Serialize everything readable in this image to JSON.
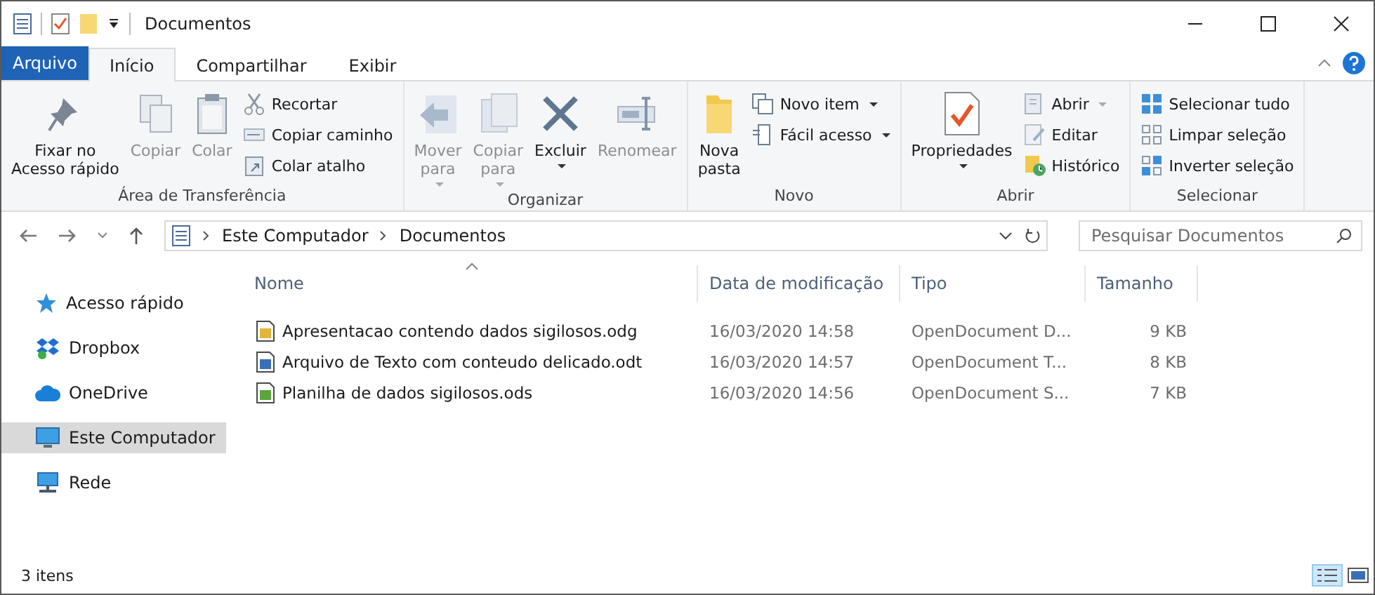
{
  "window": {
    "title": "Documentos"
  },
  "tabs": [
    {
      "label": "Arquivo",
      "kind": "menu"
    },
    {
      "label": "Início",
      "kind": "tab",
      "selected": true
    },
    {
      "label": "Compartilhar",
      "kind": "tab",
      "selected": false
    },
    {
      "label": "Exibir",
      "kind": "tab",
      "selected": false
    }
  ],
  "ribbon": {
    "groups": [
      {
        "label": "Área de Transferência",
        "items": [
          {
            "kind": "large",
            "label": "Fixar no\nAcesso rápido",
            "disabled": false,
            "dropdown": false
          },
          {
            "kind": "large",
            "label": "Copiar",
            "disabled": true,
            "dropdown": false
          },
          {
            "kind": "large",
            "label": "Colar",
            "disabled": true,
            "dropdown": false
          },
          {
            "kind": "small",
            "label": "Recortar",
            "disabled": true,
            "dropdown": false
          },
          {
            "kind": "small",
            "label": "Copiar caminho",
            "disabled": true,
            "dropdown": false
          },
          {
            "kind": "small",
            "label": "Colar atalho",
            "disabled": true,
            "dropdown": false
          }
        ]
      },
      {
        "label": "Organizar",
        "items": [
          {
            "kind": "large",
            "label": "Mover\npara",
            "disabled": true,
            "dropdown": true
          },
          {
            "kind": "large",
            "label": "Copiar\npara",
            "disabled": true,
            "dropdown": true
          },
          {
            "kind": "large",
            "label": "Excluir",
            "disabled": false,
            "dropdown": true
          },
          {
            "kind": "large",
            "label": "Renomear",
            "disabled": true,
            "dropdown": false
          }
        ]
      },
      {
        "label": "Novo",
        "items": [
          {
            "kind": "large",
            "label": "Nova\npasta",
            "disabled": false,
            "dropdown": false
          },
          {
            "kind": "small",
            "label": "Novo item",
            "disabled": false,
            "dropdown": true
          },
          {
            "kind": "small",
            "label": "Fácil acesso",
            "disabled": false,
            "dropdown": true
          }
        ]
      },
      {
        "label": "Abrir",
        "items": [
          {
            "kind": "large",
            "label": "Propriedades",
            "disabled": false,
            "dropdown": true
          },
          {
            "kind": "small",
            "label": "Abrir",
            "disabled": true,
            "dropdown": true
          },
          {
            "kind": "small",
            "label": "Editar",
            "disabled": true,
            "dropdown": false
          },
          {
            "kind": "small",
            "label": "Histórico",
            "disabled": false,
            "dropdown": false
          }
        ]
      },
      {
        "label": "Selecionar",
        "items": [
          {
            "kind": "small",
            "label": "Selecionar tudo",
            "disabled": false,
            "dropdown": false
          },
          {
            "kind": "small",
            "label": "Limpar seleção",
            "disabled": false,
            "dropdown": false
          },
          {
            "kind": "small",
            "label": "Inverter seleção",
            "disabled": false,
            "dropdown": false
          }
        ]
      }
    ]
  },
  "address": {
    "breadcrumbs": [
      "Este Computador",
      "Documentos"
    ]
  },
  "search": {
    "placeholder": "Pesquisar Documentos"
  },
  "sidebar": {
    "items": [
      {
        "label": "Acesso rápido",
        "selected": false
      },
      {
        "label": "Dropbox",
        "selected": false
      },
      {
        "label": "OneDrive",
        "selected": false
      },
      {
        "label": "Este Computador",
        "selected": true
      },
      {
        "label": "Rede",
        "selected": false
      }
    ]
  },
  "table": {
    "columns": [
      "Nome",
      "Data de modificação",
      "Tipo",
      "Tamanho"
    ],
    "rows": [
      [
        "Apresentacao contendo dados sigilosos.odg",
        "16/03/2020 14:58",
        "OpenDocument D...",
        "9 KB"
      ],
      [
        "Arquivo de Texto com conteudo delicado.odt",
        "16/03/2020 14:57",
        "OpenDocument T...",
        "8 KB"
      ],
      [
        "Planilha de dados sigilosos.ods",
        "16/03/2020 14:56",
        "OpenDocument S...",
        "7 KB"
      ]
    ]
  },
  "status_bar": {
    "text": "3 itens",
    "views": [
      {
        "selected": true
      },
      {
        "selected": false
      }
    ]
  }
}
